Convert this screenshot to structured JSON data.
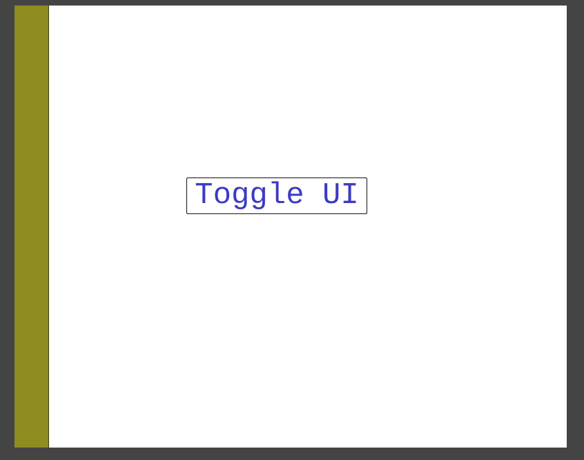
{
  "toggle_button": {
    "label": "Toggle UI"
  },
  "colors": {
    "outer_background": "#444444",
    "canvas_background": "#ffffff",
    "side_bar": "#8f8c21",
    "button_text": "#3b3bc4",
    "button_border": "#111111"
  }
}
